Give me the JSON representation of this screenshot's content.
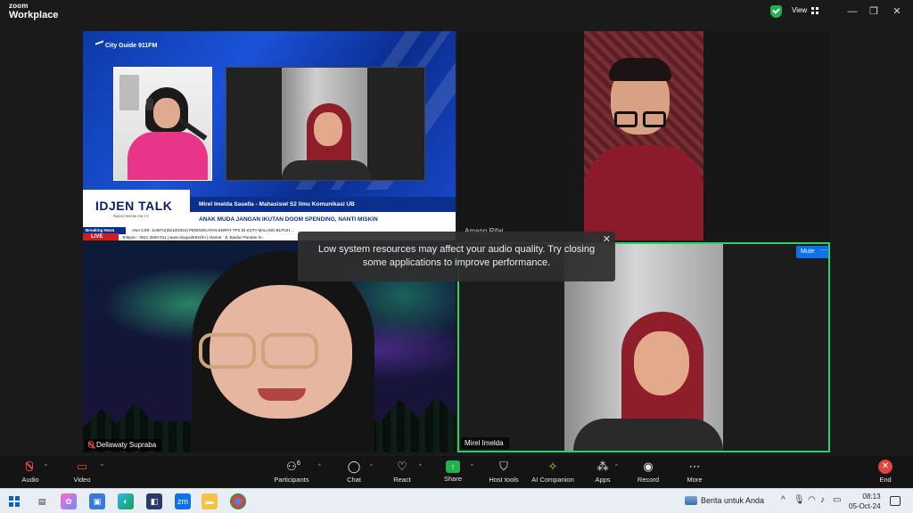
{
  "app": {
    "brand_top": "zoom",
    "brand_bottom": "Workplace",
    "view_label": "View"
  },
  "window_controls": {
    "minimize": "—",
    "restore": "❐",
    "close": "✕"
  },
  "tv_tile": {
    "logo": "City Guide 911FM",
    "show_name": "IDJEN TALK",
    "show_sub": "RADIO SHOW ON TV",
    "guest_line": "Mirel Imelda Sasella - Mahasiswi S2 Ilmu Komunikasi UB",
    "headline": "ANAK MUDA JANGAN IKUTAN DOOM SPENDING, NANTI MISKIN",
    "breaking": "Breaking News",
    "live": "LIVE",
    "ticker_1": "ANA CSR.   SABTU(05/10/2024) PENINGKATAN EMPAT TPS DI KOTA MALANG BUTUH ...",
    "ticker_2": "Telepon : 0811-3600-911 | www.cityguide911fm | Alamat : Jl. Baiduri Pandan N...",
    "watermark": "cityguide911fm"
  },
  "participants": {
    "amang": {
      "name": "Amang Rifai"
    },
    "dellawaty": {
      "name": "Dellawaty Supraba"
    },
    "mirel": {
      "name": "Mirel Imelda",
      "mute_label": "Mute",
      "more_label": "···"
    }
  },
  "toast": {
    "message": "Low system resources may affect your audio quality. Try closing some applications to improve performance.",
    "close": "✕"
  },
  "toolbar": {
    "audio": "Audio",
    "video": "Video",
    "participants": "Participants",
    "participants_count": "6",
    "chat": "Chat",
    "react": "React",
    "share": "Share",
    "host_tools": "Host tools",
    "ai_companion": "AI Companion",
    "apps": "Apps",
    "record": "Record",
    "more": "More",
    "end": "End"
  },
  "taskbar": {
    "news": "Berita untuk Anda",
    "time": "08:13",
    "date": "05-Oct-24"
  },
  "colors": {
    "accent": "#0e71eb",
    "active_speaker": "#2bd16a",
    "end_red": "#e0463d",
    "share_green": "#22b14c"
  }
}
